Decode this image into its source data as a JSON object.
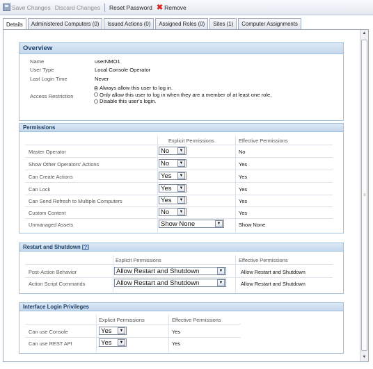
{
  "toolbar": {
    "save_label": "Save Changes",
    "discard_label": "Discard Changes",
    "reset_password_label": "Reset Password",
    "remove_label": "Remove"
  },
  "tabs": [
    {
      "label": "Details"
    },
    {
      "label": "Administered Computers (0)"
    },
    {
      "label": "Issued Actions (0)"
    },
    {
      "label": "Assigned Roles (0)"
    },
    {
      "label": "Sites (1)"
    },
    {
      "label": "Computer Assignments"
    }
  ],
  "overview": {
    "title": "Overview",
    "name_label": "Name",
    "name_value": "userNMO1",
    "type_label": "User Type",
    "type_value": "Local Console Operator",
    "login_label": "Last Login Time",
    "login_value": "Never",
    "access_label": "Access Restriction",
    "access_options": [
      "Always allow this user to log in.",
      "Only allow this user to log in when they are a member of at least one role.",
      "Disable this user's login."
    ]
  },
  "permissions": {
    "title": "Permissions",
    "col_explicit": "Explicit Permissions",
    "col_effective": "Effective Permissions",
    "rows": [
      {
        "label": "Master Operator",
        "explicit": "No",
        "effective": "No"
      },
      {
        "label": "Show Other Operators' Actions",
        "explicit": "No",
        "effective": "Yes"
      },
      {
        "label": "Can Create Actions",
        "explicit": "Yes",
        "effective": "Yes"
      },
      {
        "label": "Can Lock",
        "explicit": "Yes",
        "effective": "Yes"
      },
      {
        "label": "Can Send Refresh to Multiple Computers",
        "explicit": "Yes",
        "effective": "Yes"
      },
      {
        "label": "Custom Content",
        "explicit": "No",
        "effective": "Yes"
      },
      {
        "label": "Unmanaged Assets",
        "explicit": "Show None",
        "effective": "Show None"
      }
    ]
  },
  "restart": {
    "title": "Restart and Shutdown [",
    "help_link": "?",
    "title_end": "]",
    "col_explicit": "Explicit Permissions",
    "col_effective": "Effective Permissions",
    "rows": [
      {
        "label": "Post-Action Behavior",
        "explicit": "Allow Restart and Shutdown",
        "effective": "Allow Restart and Shutdown"
      },
      {
        "label": "Action Script Commands",
        "explicit": "Allow Restart and Shutdown",
        "effective": "Allow Restart and Shutdown"
      }
    ]
  },
  "interface": {
    "title": "Interface Login Privileges",
    "col_explicit": "Explicit Permissions",
    "col_effective": "Effective Permissions",
    "rows": [
      {
        "label": "Can use Console",
        "explicit": "Yes",
        "effective": "Yes"
      },
      {
        "label": "Can use REST API",
        "explicit": "Yes",
        "effective": "Yes"
      }
    ]
  },
  "colors": {
    "panel_header_bg": "#c4d8ec",
    "panel_border": "#9fc1de",
    "panel_title_text": "#1d3f66",
    "remove_icon": "#dd2222"
  },
  "icons": [
    "save-icon",
    "remove-icon",
    "dropdown-arrow-icon",
    "scroll-up-icon",
    "scroll-down-icon"
  ]
}
